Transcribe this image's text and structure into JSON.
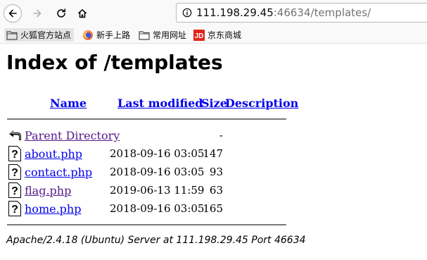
{
  "browser": {
    "url_host": "111.198.29.45",
    "url_rest": ":46634/templates/"
  },
  "bookmarks": [
    {
      "label": "火狐官方站点",
      "icon": "folder-icon"
    },
    {
      "label": "新手上路",
      "icon": "firefox-icon"
    },
    {
      "label": "常用网址",
      "icon": "folder-icon"
    },
    {
      "label": "京东商城",
      "icon": "jd-icon",
      "color": "#e1251b"
    }
  ],
  "page": {
    "title": "Index of /templates",
    "columns": {
      "name": "Name",
      "modified": "Last modified",
      "size": "Size",
      "description": "Description"
    },
    "parent": {
      "name": "Parent Directory",
      "size": "-"
    },
    "files": [
      {
        "name": "about.php",
        "modified": "2018-09-16 03:05",
        "size": "147"
      },
      {
        "name": "contact.php",
        "modified": "2018-09-16 03:05",
        "size": "93"
      },
      {
        "name": "flag.php",
        "modified": "2019-06-13 11:59",
        "size": "63"
      },
      {
        "name": "home.php",
        "modified": "2018-09-16 03:05",
        "size": "165"
      }
    ],
    "footer": "Apache/2.4.18 (Ubuntu) Server at 111.198.29.45 Port 46634"
  },
  "colors": {
    "link": "#0000ee",
    "visited": "#551a8b"
  }
}
